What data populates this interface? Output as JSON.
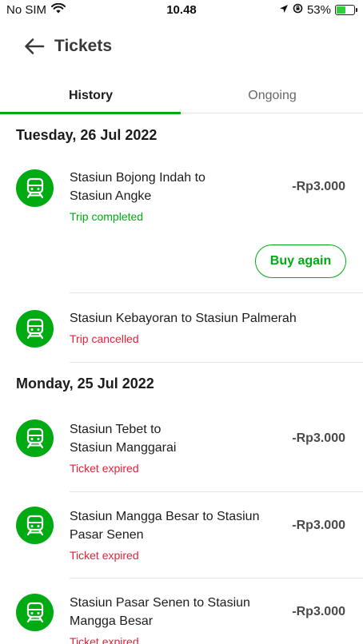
{
  "status_bar": {
    "carrier": "No SIM",
    "time": "10.48",
    "battery": "53%",
    "battery_level": 0.53
  },
  "header": {
    "title": "Tickets",
    "back_icon": "arrow-left-icon"
  },
  "tabs": [
    {
      "label": "History",
      "active": true
    },
    {
      "label": "Ongoing",
      "active": false
    }
  ],
  "sections": [
    {
      "date": "Tuesday, 26 Jul 2022",
      "trips": [
        {
          "route_line1": "Stasiun Bojong Indah to",
          "route_line2": "Stasiun Angke",
          "status": "Trip completed",
          "price": "-Rp3.000",
          "action": "Buy again"
        },
        {
          "route_line1": "Stasiun Kebayoran to Stasiun Palmerah",
          "route_line2": "",
          "status": "Trip cancelled",
          "price": ""
        }
      ]
    },
    {
      "date": "Monday, 25 Jul 2022",
      "trips": [
        {
          "route_line1": "Stasiun Tebet to",
          "route_line2": "Stasiun Manggarai",
          "status": "Ticket expired",
          "price": "-Rp3.000"
        },
        {
          "route_line1": "Stasiun Mangga Besar to Stasiun",
          "route_line2": "Pasar Senen",
          "status": "Ticket expired",
          "price": "-Rp3.000"
        },
        {
          "route_line1": "Stasiun Pasar Senen to Stasiun",
          "route_line2": "Mangga Besar",
          "status": "Ticket expired",
          "price": "-Rp3.000"
        }
      ]
    }
  ],
  "colors": {
    "accent": "#00aa13",
    "error": "#e0223a"
  },
  "icons": {
    "trip": "train-icon",
    "wifi": "wifi-icon",
    "location": "location-arrow-icon",
    "rotation_lock": "rotation-lock-icon",
    "battery": "battery-charging-icon"
  }
}
